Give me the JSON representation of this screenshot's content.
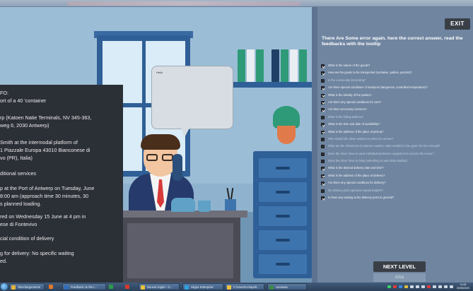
{
  "scene": {
    "bubble_text": "Hello"
  },
  "info_panel": {
    "lines": [
      "FO:",
      "ort of a 40 'container",
      "rp (Katoen Natie Terminals, NV 345-363,",
      "weg 6, 2030 Antwerp)",
      "Smith at the intermodal platform of",
      "1 Piazzale Europa 43010 Bianconese di",
      "vo (PR), Italia)",
      "ditional services",
      "p at the Port of Antwerp on Tuesday, June",
      "8:00 am (approach time 30 minutes, 30",
      "s planned loading.",
      "red on Wednesday 15 June at 4 pm in",
      "ese di Fontevivo",
      "cial condition of delivery",
      "g for delivery: No specific waiting",
      "ed."
    ]
  },
  "right_panel": {
    "exit_label": "EXIT",
    "heading": "There Are Some error again. here the correct answer, read the feedbacks with the tooltip",
    "questions": [
      {
        "text": "What is the nature of the goods?",
        "checked": true,
        "faded": false
      },
      {
        "text": "How are the goods to be transported (container, pallets, parcels)?",
        "checked": true,
        "faded": false
      },
      {
        "text": "Is the commodity interesting?",
        "checked": false,
        "faded": true
      },
      {
        "text": "Are there special conditions of transport (dangerous, controlled temperature)?",
        "checked": true,
        "faded": false
      },
      {
        "text": "What is the identity of the parties?",
        "checked": true,
        "faded": false
      },
      {
        "text": "Are there any special conditions for care?",
        "checked": true,
        "faded": false
      },
      {
        "text": "Are there accessory services?",
        "checked": true,
        "faded": false
      },
      {
        "text": "What is the billing address?",
        "checked": false,
        "faded": true
      },
      {
        "text": "What is the time and date of availability?",
        "checked": true,
        "faded": false
      },
      {
        "text": "What is the address of the place of pickup?",
        "checked": true,
        "faded": false
      },
      {
        "text": "Who should the driver address to when he arrives?",
        "checked": false,
        "faded": true
      },
      {
        "text": "What are the references (container number, order number) to be given for the removal?",
        "checked": false,
        "faded": true
      },
      {
        "text": "Does the driver have to wear individual protection equipment to access the venue?",
        "checked": false,
        "faded": true
      },
      {
        "text": "Does the driver have to bring something to wait while loading?",
        "checked": false,
        "faded": true
      },
      {
        "text": "What is the desired delivery date and time?",
        "checked": true,
        "faded": false
      },
      {
        "text": "What is the address of the place of delivery?",
        "checked": true,
        "faded": false
      },
      {
        "text": "Are there any special conditions for delivery?",
        "checked": true,
        "faded": false
      },
      {
        "text": "Do delivery point operators speak English?",
        "checked": false,
        "faded": true
      },
      {
        "text": "Is there any waiting at the delivery point in general?",
        "checked": true,
        "faded": false
      }
    ],
    "next_label": "NEXT LEVEL",
    "faded_label": "Arka"
  },
  "taskbar": {
    "items": [
      {
        "label": "Telechargements",
        "color": "#e3b23c"
      },
      {
        "label": "",
        "color": "#e07a2a"
      },
      {
        "label": "Feedback on the t...",
        "color": "#2f6fc0"
      },
      {
        "label": "",
        "color": "#2e9a4a"
      },
      {
        "label": "",
        "color": "#d63a2a"
      },
      {
        "label": "Nouvel onglet - G...",
        "color": "#e8c23a"
      },
      {
        "label": "Skype Entreprise",
        "color": "#2fa0e0"
      },
      {
        "label": "C:\\Users\\cchapell...",
        "color": "#f0c040"
      },
      {
        "label": "camtasia",
        "color": "#3a8a4a"
      }
    ],
    "clock_time": "11:08",
    "clock_date": "20/05/2020"
  }
}
